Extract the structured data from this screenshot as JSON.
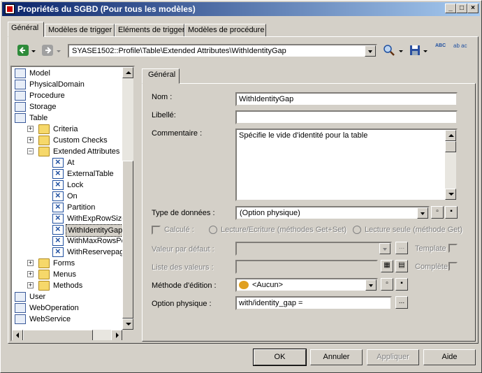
{
  "window": {
    "title": "Propriétés du SGBD (Pour tous les modèles)",
    "controls": {
      "minimize": "_",
      "maximize": "□",
      "close": "×"
    }
  },
  "tabs": [
    {
      "label": "Général",
      "active": true
    },
    {
      "label": "Modèles de trigger",
      "active": false
    },
    {
      "label": "Eléments de trigger",
      "active": false
    },
    {
      "label": "Modèles de procédure",
      "active": false
    }
  ],
  "path": {
    "value": "SYASE1502::Profile\\Table\\Extended Attributes\\WithIdentityGap"
  },
  "toolbar": {
    "back_icon": "arrow-left-icon",
    "forward_icon": "arrow-right-icon",
    "find_icon": "magnifier-icon",
    "save_icon": "floppy-icon",
    "spell_label": "ABC",
    "replace_label": "ab ac"
  },
  "tree": {
    "items": [
      {
        "label": "Model",
        "icon": "model-icon",
        "level": 0
      },
      {
        "label": "PhysicalDomain",
        "icon": "domain-icon",
        "level": 0
      },
      {
        "label": "Procedure",
        "icon": "procedure-icon",
        "level": 0
      },
      {
        "label": "Storage",
        "icon": "storage-icon",
        "level": 0
      },
      {
        "label": "Table",
        "icon": "table-icon",
        "level": 0
      },
      {
        "label": "Criteria",
        "icon": "folder-icon",
        "level": 1,
        "expander": "+"
      },
      {
        "label": "Custom Checks",
        "icon": "folder-icon",
        "level": 1,
        "expander": "+"
      },
      {
        "label": "Extended Attributes",
        "icon": "folder-open-icon",
        "level": 1,
        "expander": "-"
      },
      {
        "label": "At",
        "icon": "extended-attribute-icon",
        "level": 2
      },
      {
        "label": "ExternalTable",
        "icon": "extended-attribute-icon",
        "level": 2
      },
      {
        "label": "Lock",
        "icon": "extended-attribute-icon",
        "level": 2
      },
      {
        "label": "On",
        "icon": "extended-attribute-icon",
        "level": 2
      },
      {
        "label": "Partition",
        "icon": "extended-attribute-icon",
        "level": 2
      },
      {
        "label": "WithExpRowSize",
        "icon": "extended-attribute-icon",
        "level": 2
      },
      {
        "label": "WithIdentityGap",
        "icon": "extended-attribute-icon",
        "level": 2,
        "selected": true
      },
      {
        "label": "WithMaxRowsPerPa",
        "icon": "extended-attribute-icon",
        "level": 2
      },
      {
        "label": "WithReservepagega",
        "icon": "extended-attribute-icon",
        "level": 2
      },
      {
        "label": "Forms",
        "icon": "folder-icon",
        "level": 1,
        "expander": "+"
      },
      {
        "label": "Menus",
        "icon": "folder-icon",
        "level": 1,
        "expander": "+"
      },
      {
        "label": "Methods",
        "icon": "folder-icon",
        "level": 1,
        "expander": "+"
      },
      {
        "label": "User",
        "icon": "user-icon",
        "level": 0
      },
      {
        "label": "WebOperation",
        "icon": "web-operation-icon",
        "level": 0
      },
      {
        "label": "WebService",
        "icon": "web-service-icon",
        "level": 0
      }
    ]
  },
  "inner_tab": {
    "label": "Général"
  },
  "form": {
    "nom_label": "Nom :",
    "nom_value": "WithIdentityGap",
    "libelle_label": "Libellé:",
    "libelle_value": "",
    "commentaire_label": "Commentaire :",
    "commentaire_value": "Spécifie le vide d'identité pour la table",
    "type_label": "Type de données :",
    "type_value": "(Option physique)",
    "calcule_label": "Calculé :",
    "lecture_ecriture_label": "Lecture/Ecriture (méthodes Get+Set)",
    "lecture_seule_label": "Lecture seule (méthode Get)",
    "valeur_defaut_label": "Valeur par défaut :",
    "valeur_defaut_value": "",
    "template_label": "Template",
    "liste_valeurs_label": "Liste des valeurs :",
    "liste_valeurs_value": "",
    "complete_label": "Complète",
    "methode_label": "Méthode d'édition :",
    "methode_value": "<Aucun>",
    "option_label": "Option physique :",
    "option_value": "with/identity_gap =",
    "ellipsis": "..."
  },
  "buttons": {
    "ok": "OK",
    "cancel": "Annuler",
    "apply": "Appliquer",
    "help": "Aide"
  },
  "colors": {
    "title_start": "#0a246a",
    "title_end": "#a6caf0",
    "face": "#d4d0c8"
  }
}
